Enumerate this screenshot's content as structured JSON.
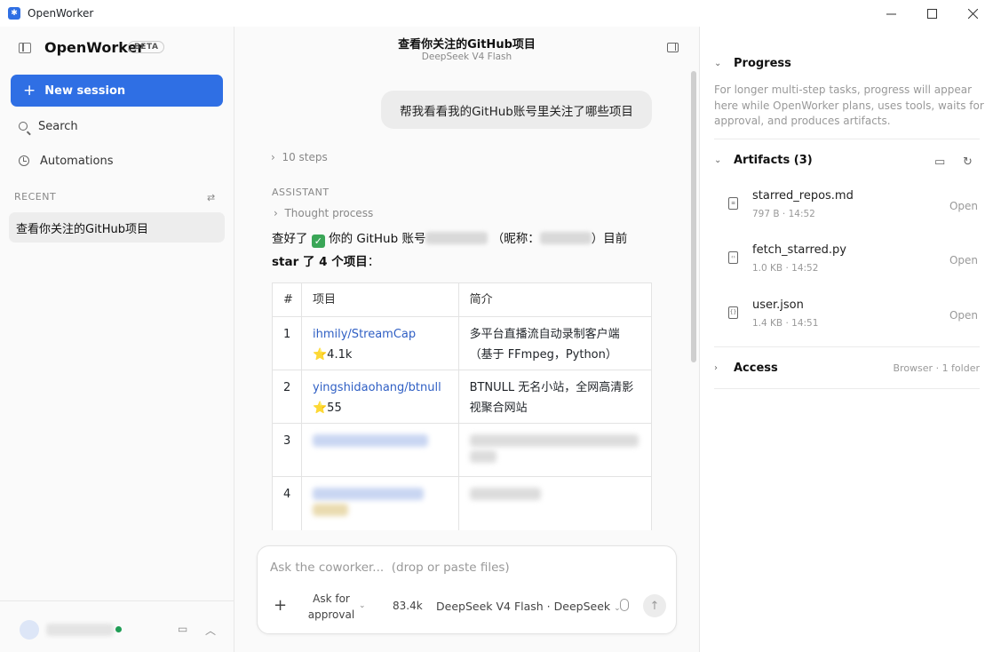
{
  "window": {
    "title": "OpenWorker"
  },
  "sidebar": {
    "brand": "OpenWorker",
    "badge": "BETA",
    "new_session": "New session",
    "search": "Search",
    "automations": "Automations",
    "recent_label": "RECENT",
    "recent_items": [
      "查看你关注的GitHub项目"
    ]
  },
  "main": {
    "title": "查看你关注的GitHub项目",
    "model_subtitle": "DeepSeek V4 Flash",
    "user_message": "帮我看看我的GitHub账号里关注了哪些项目",
    "steps": "10 steps",
    "assistant_label": "ASSISTANT",
    "thought": "Thought process",
    "answer": {
      "p1": "查好了",
      "p2": "你的 GitHub 账号",
      "p3": "（昵称：",
      "p4": "）目前",
      "p5": "star 了 4 个项目",
      "p6": "："
    },
    "table": {
      "headers": [
        "#",
        "项目",
        "简介"
      ],
      "rows": [
        {
          "num": "1",
          "repo": "ihmily/StreamCap",
          "stars": "⭐4.1k",
          "desc": "多平台直播流自动录制客户端（基于 FFmpeg，Python）"
        },
        {
          "num": "2",
          "repo": "yingshidaohang/btnull",
          "stars": "⭐55",
          "desc": "BTNULL 无名小站，全网高清影视聚合网站"
        },
        {
          "num": "3"
        },
        {
          "num": "4"
        }
      ]
    },
    "composer": {
      "placeholder": "Ask the coworker...  (drop or paste files)",
      "approval": "Ask for approval",
      "tokens": "83.4k",
      "model": "DeepSeek V4 Flash · DeepSeek"
    }
  },
  "right": {
    "progress_title": "Progress",
    "progress_text": "For longer multi-step tasks, progress will appear here while OpenWorker plans, uses tools, waits for approval, and produces artifacts.",
    "artifacts_title": "Artifacts (3)",
    "artifacts": [
      {
        "name": "starred_repos.md",
        "meta": "797 B · 14:52",
        "open": "Open"
      },
      {
        "name": "fetch_starred.py",
        "meta": "1.0 KB · 14:52",
        "open": "Open"
      },
      {
        "name": "user.json",
        "meta": "1.4 KB · 14:51",
        "open": "Open"
      }
    ],
    "access_title": "Access",
    "access_meta": "Browser · 1 folder"
  },
  "colors": {
    "accent": "#2f6fe4",
    "link": "#2f5fc4",
    "online": "#1f9d55"
  }
}
